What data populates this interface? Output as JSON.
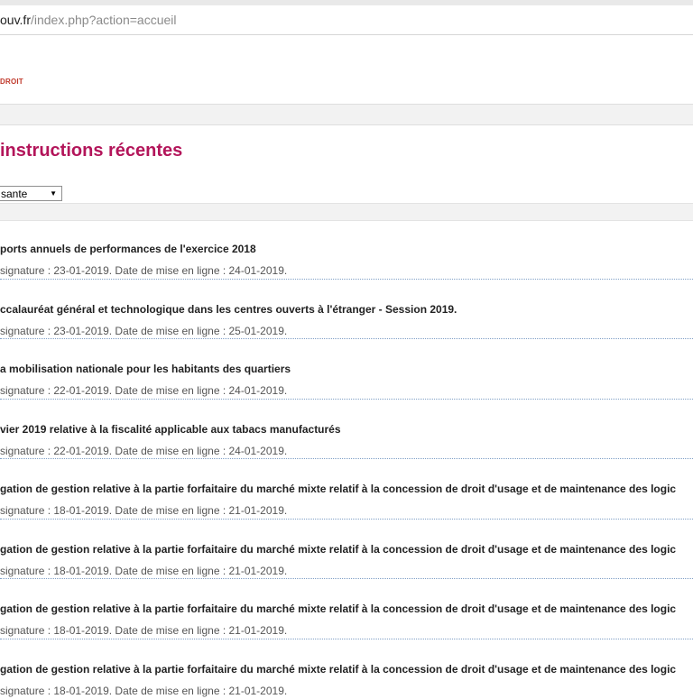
{
  "browser": {
    "url_host": "ouv.fr",
    "url_path": "/index.php?action=accueil"
  },
  "header": {
    "logo_text": "DROIT"
  },
  "page": {
    "title": "instructions récentes",
    "sort_select_value": "sante"
  },
  "items": [
    {
      "title": "ports annuels de performances de l'exercice 2018",
      "meta": "signature : 23-01-2019. Date de mise en ligne : 24-01-2019."
    },
    {
      "title": "ccalauréat général et technologique dans les centres ouverts à l'étranger - Session 2019.",
      "meta": "signature : 23-01-2019. Date de mise en ligne : 25-01-2019."
    },
    {
      "title": "a mobilisation nationale pour les habitants des quartiers",
      "meta": "signature : 22-01-2019. Date de mise en ligne : 24-01-2019."
    },
    {
      "title": "vier 2019 relative à la fiscalité applicable aux tabacs manufacturés",
      "meta": "signature : 22-01-2019. Date de mise en ligne : 24-01-2019."
    },
    {
      "title": "gation de gestion relative à la partie forfaitaire du marché mixte relatif à la concession de droit d'usage et de maintenance des logic",
      "meta": "signature : 18-01-2019. Date de mise en ligne : 21-01-2019."
    },
    {
      "title": "gation de gestion relative à la partie forfaitaire du marché mixte relatif à la concession de droit d'usage et de maintenance des logic",
      "meta": "signature : 18-01-2019. Date de mise en ligne : 21-01-2019."
    },
    {
      "title": "gation de gestion relative à la partie forfaitaire du marché mixte relatif à la concession de droit d'usage et de maintenance des logic",
      "meta": "signature : 18-01-2019. Date de mise en ligne : 21-01-2019."
    },
    {
      "title": "gation de gestion relative à la partie forfaitaire du marché mixte relatif à la concession de droit d'usage et de maintenance des logic",
      "meta": "signature : 18-01-2019. Date de mise en ligne : 21-01-2019."
    }
  ]
}
